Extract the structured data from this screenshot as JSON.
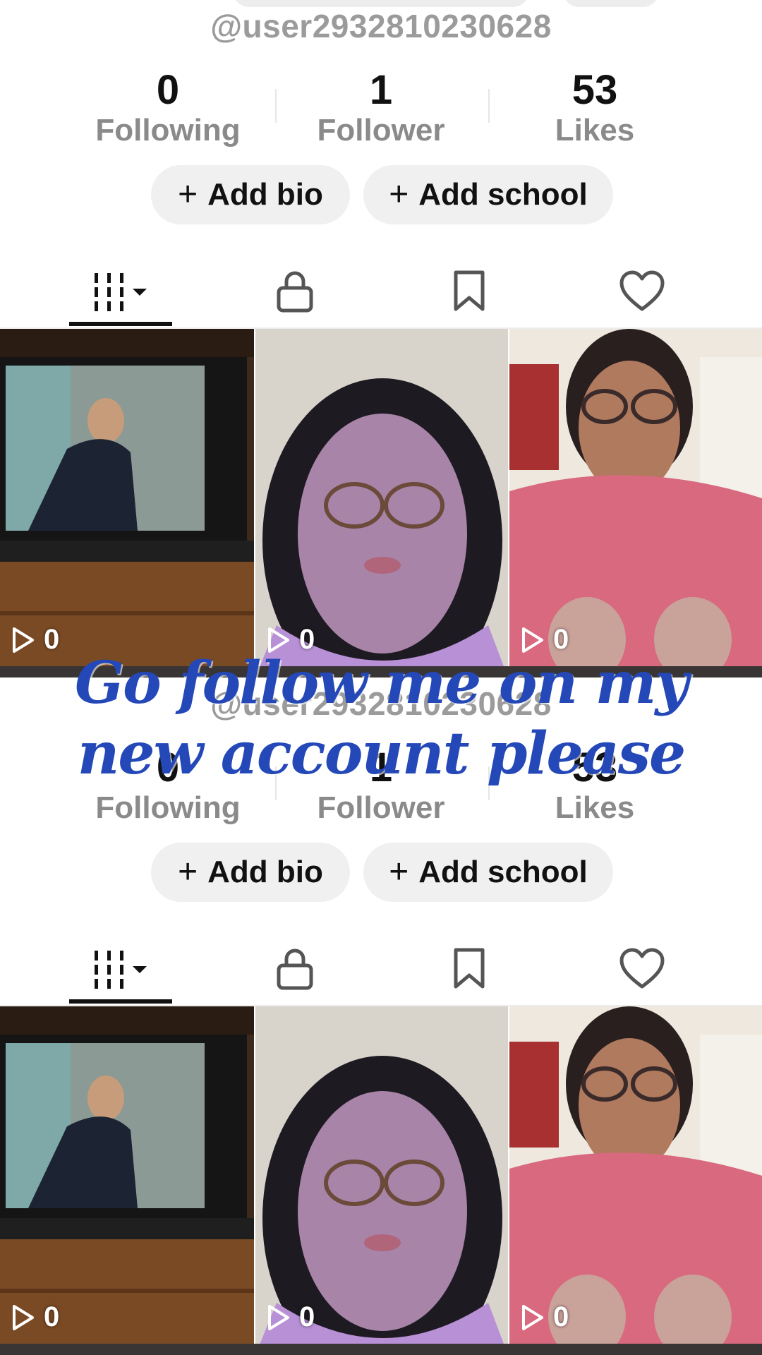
{
  "profile": {
    "handle": "@user2932810230628",
    "stats": [
      {
        "value": "0",
        "label": "Following"
      },
      {
        "value": "1",
        "label": "Follower"
      },
      {
        "value": "53",
        "label": "Likes"
      }
    ],
    "buttons": {
      "add_bio": "Add bio",
      "add_school": "Add school",
      "plus": "+"
    }
  },
  "tabs": [
    {
      "icon": "videos-grid-icon",
      "active": true
    },
    {
      "icon": "lock-icon"
    },
    {
      "icon": "bookmark-icon"
    },
    {
      "icon": "heart-icon"
    }
  ],
  "videos": [
    {
      "views": "0",
      "thumbnail": "man-on-tv-screen"
    },
    {
      "views": "0",
      "thumbnail": "woman-with-glasses-selfie"
    },
    {
      "views": "0",
      "thumbnail": "woman-in-pink-shirt"
    }
  ],
  "overlay_caption": {
    "line1": "Go follow me on my",
    "line2": "new account please"
  },
  "colors": {
    "caption": "#2448b8",
    "label_gray": "#8a8a8a",
    "pill_bg": "#f0f0f0"
  }
}
